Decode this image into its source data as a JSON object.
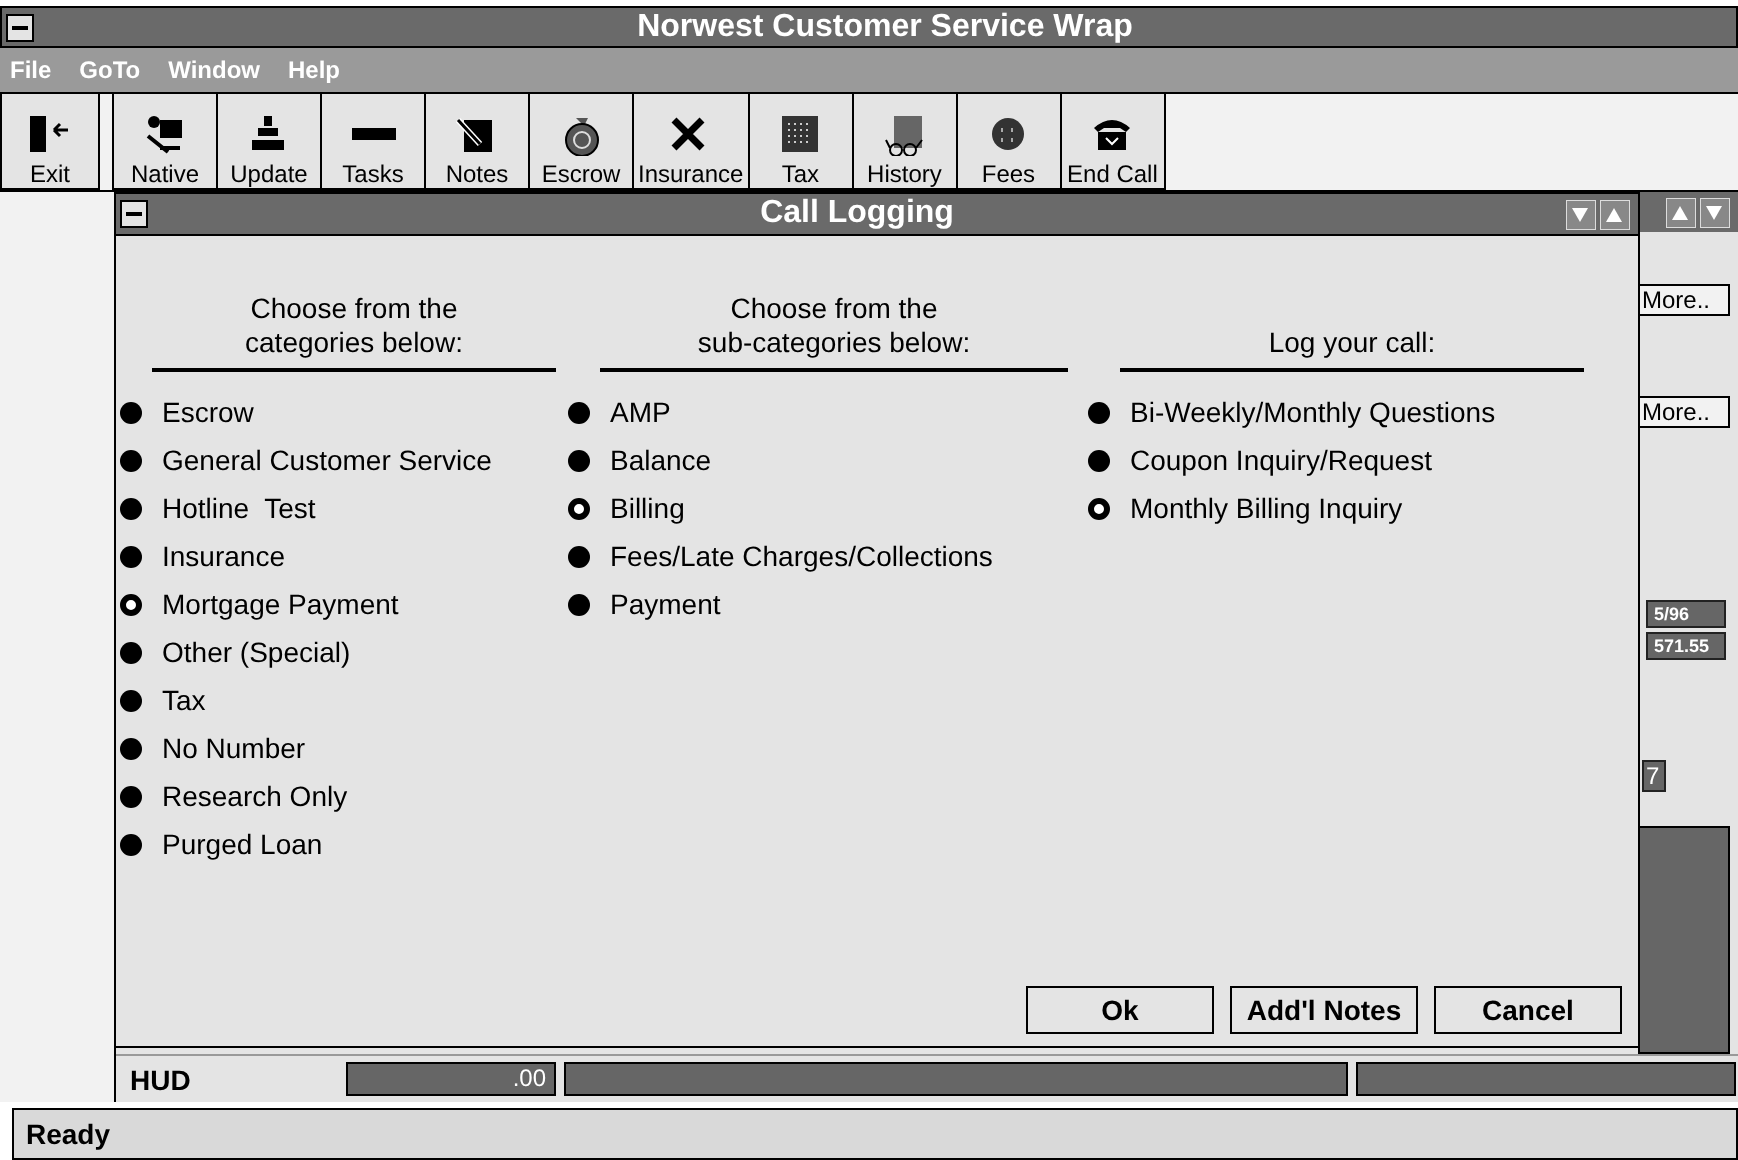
{
  "window": {
    "title": "Norwest Customer Service Wrap"
  },
  "menu": [
    "File",
    "GoTo",
    "Window",
    "Help"
  ],
  "toolbar": [
    {
      "label": "Exit"
    },
    {
      "label": "Native"
    },
    {
      "label": "Update"
    },
    {
      "label": "Tasks"
    },
    {
      "label": "Notes"
    },
    {
      "label": "Escrow"
    },
    {
      "label": "Insurance"
    },
    {
      "label": "Tax"
    },
    {
      "label": "History"
    },
    {
      "label": "Fees"
    },
    {
      "label": "End Call"
    }
  ],
  "background_window": {
    "buttons": [
      "More..",
      "More.."
    ],
    "fields": [
      "5/96",
      "571.55",
      "7"
    ]
  },
  "dialog": {
    "title": "Call Logging",
    "columns": [
      {
        "heading": "Choose from the\ncategories below:",
        "options": [
          {
            "label": "Escrow",
            "selected": false
          },
          {
            "label": "General Customer Service",
            "selected": false
          },
          {
            "label": "Hotline  Test",
            "selected": false
          },
          {
            "label": "Insurance",
            "selected": false
          },
          {
            "label": "Mortgage Payment",
            "selected": true
          },
          {
            "label": "Other (Special)",
            "selected": false
          },
          {
            "label": "Tax",
            "selected": false
          },
          {
            "label": "No Number",
            "selected": false
          },
          {
            "label": "Research Only",
            "selected": false
          },
          {
            "label": "Purged Loan",
            "selected": false
          }
        ]
      },
      {
        "heading": "Choose from the\nsub-categories below:",
        "options": [
          {
            "label": "AMP",
            "selected": false
          },
          {
            "label": "Balance",
            "selected": false
          },
          {
            "label": "Billing",
            "selected": true
          },
          {
            "label": "Fees/Late Charges/Collections",
            "selected": false
          },
          {
            "label": "Payment",
            "selected": false
          }
        ]
      },
      {
        "heading": "Log your call:",
        "options": [
          {
            "label": "Bi-Weekly/Monthly Questions",
            "selected": false
          },
          {
            "label": "Coupon Inquiry/Request",
            "selected": false
          },
          {
            "label": "Monthly Billing Inquiry",
            "selected": true
          }
        ]
      }
    ],
    "buttons": [
      "Ok",
      "Add'l Notes",
      "Cancel"
    ]
  },
  "hud": {
    "label": "HUD",
    "amount": ".00"
  },
  "status_bar": "Ready"
}
